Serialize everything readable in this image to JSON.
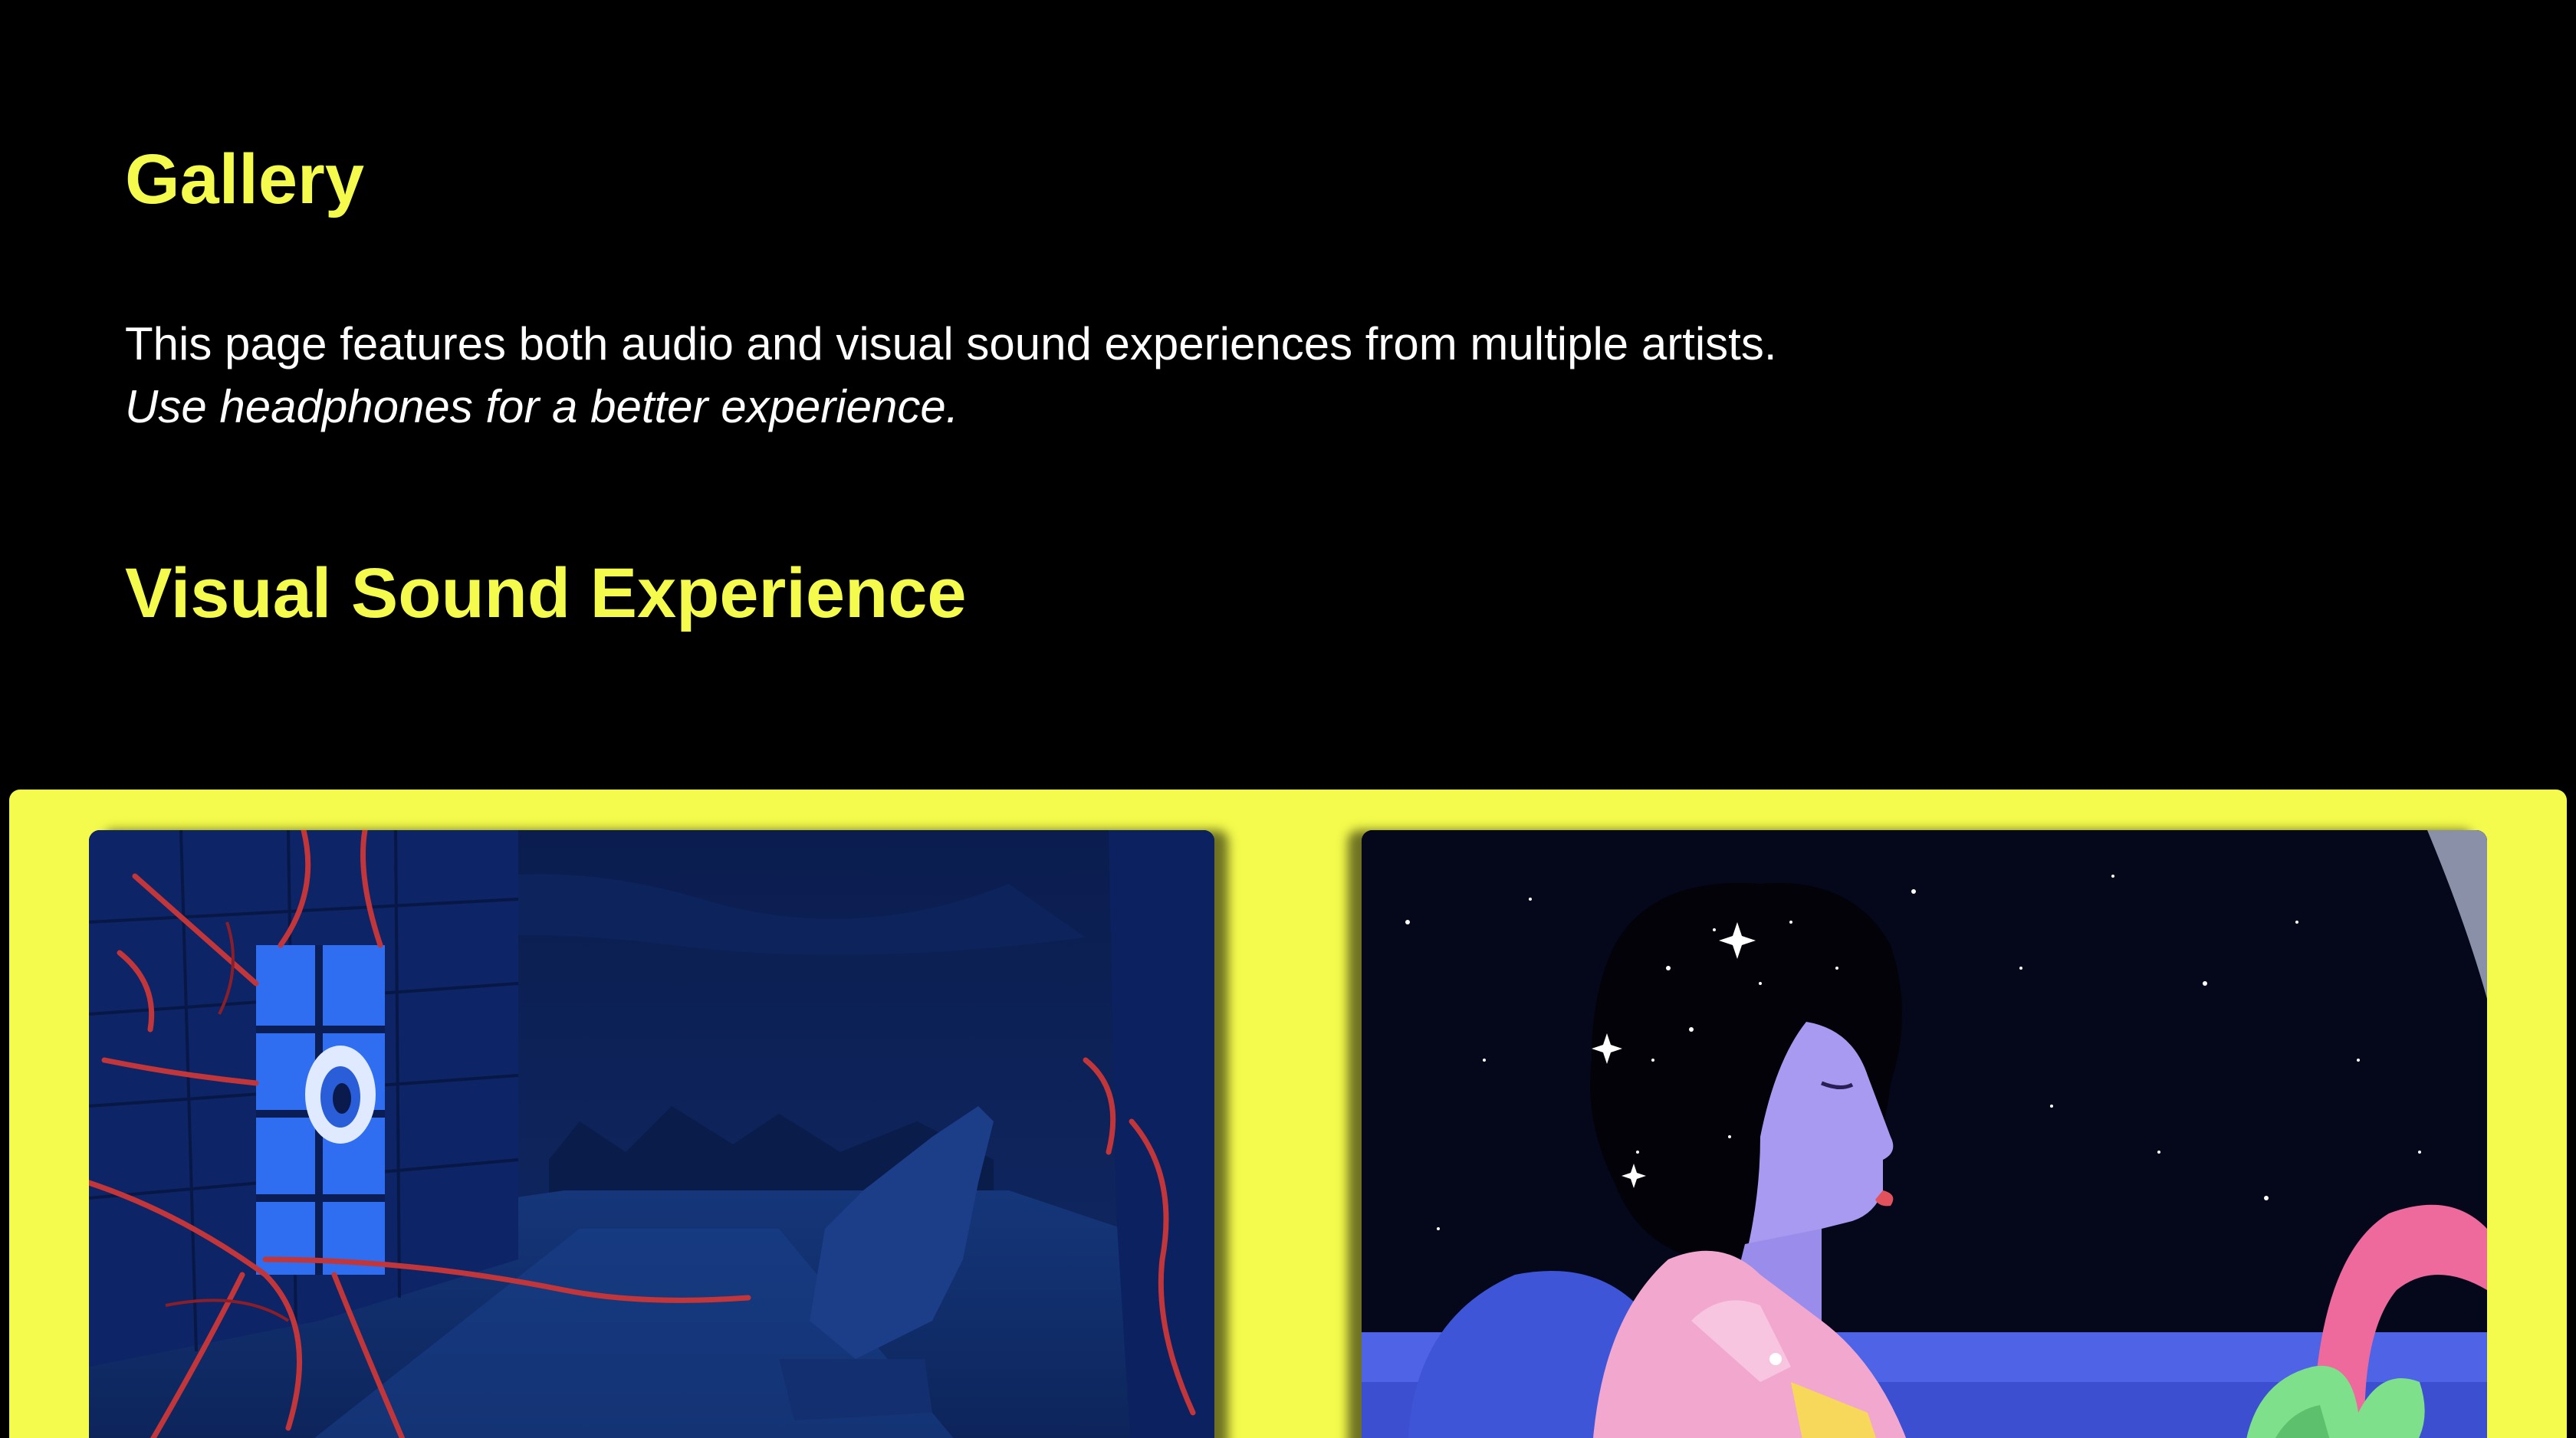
{
  "page": {
    "title": "Gallery",
    "intro": "This page features both audio and visual sound experiences from multiple artists.",
    "tip": "Use headphones for a better experience.",
    "section_title": "Visual Sound Experience"
  },
  "colors": {
    "accent": "#f4fb4c",
    "background": "#000000",
    "text": "#ffffff"
  },
  "gallery": {
    "items": [
      {
        "name": "visual-sound-experience-1",
        "icon": "video-thumbnail"
      },
      {
        "name": "visual-sound-experience-2",
        "icon": "video-thumbnail"
      }
    ]
  }
}
